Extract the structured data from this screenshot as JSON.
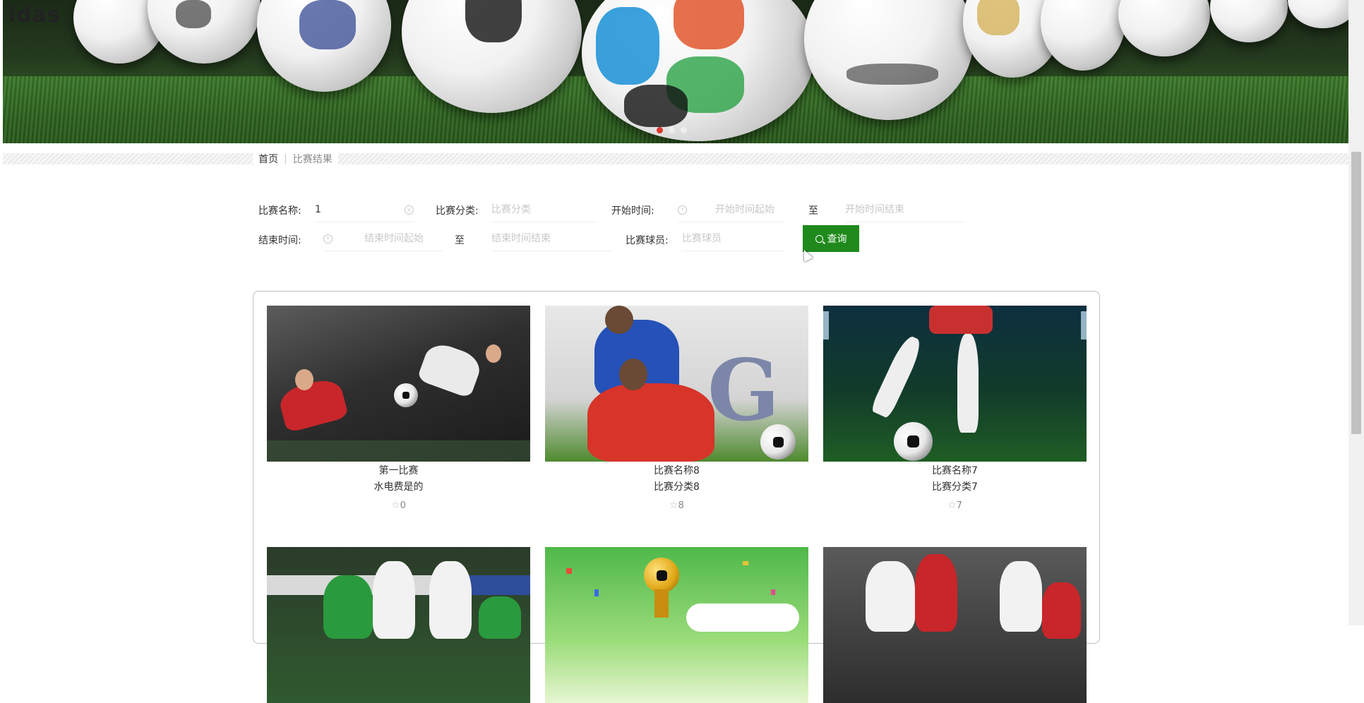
{
  "banner": {
    "logo_text": "idas"
  },
  "breadcrumb": {
    "home": "首页",
    "current": "比赛结果"
  },
  "search": {
    "name_label": "比赛名称:",
    "name_value": "1",
    "category_label": "比赛分类:",
    "category_placeholder": "比赛分类",
    "start_label": "开始时间:",
    "start_from_placeholder": "开始时间起始",
    "start_to_placeholder": "开始时间结束",
    "end_label": "结束时间:",
    "end_from_placeholder": "结束时间起始",
    "end_to_placeholder": "结束时间结束",
    "to_text": "至",
    "player_label": "比赛球员:",
    "player_placeholder": "比赛球员",
    "button_label": "查询"
  },
  "cards": [
    {
      "name": "第一比赛",
      "category": "水电费是的",
      "favorites": "0"
    },
    {
      "name": "比赛名称8",
      "category": "比赛分类8",
      "favorites": "8"
    },
    {
      "name": "比赛名称7",
      "category": "比赛分类7",
      "favorites": "7"
    }
  ],
  "colors": {
    "accent": "#1f8a1b"
  }
}
